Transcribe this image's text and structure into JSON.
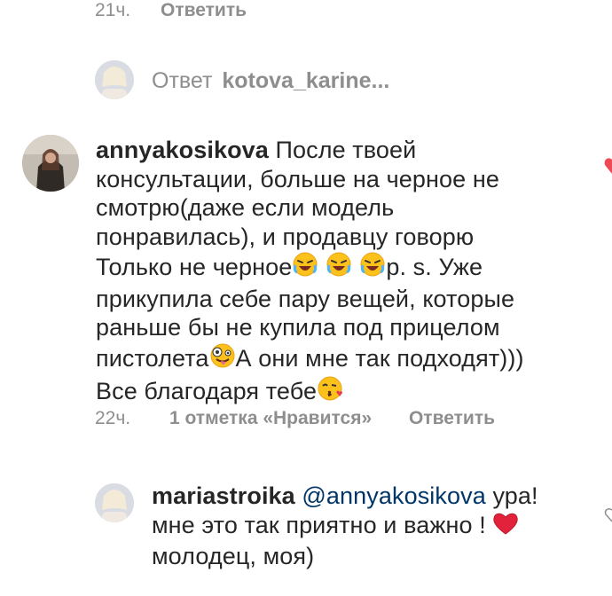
{
  "top_comment_meta": {
    "time": "21ч.",
    "reply": "Ответить"
  },
  "view_replies": {
    "prefix": "Ответ",
    "user": "kotova_karine..."
  },
  "comment1": {
    "username": "annyakosikova",
    "lines": [
      "После твоей",
      "консультации, больше на черное не",
      "смотрю(даже если модель",
      "понравилась), и продавцу говорю"
    ],
    "line5_text": "Только не черное",
    "line5_after": "p. s. Уже",
    "line6": "прикупила себе пару вещей, которые",
    "line7": "раньше бы не купила под прицелом",
    "line8_before": "пистолета",
    "line8_after": "А они мне так подходят)))",
    "line9": "Все благодаря тебе",
    "meta": {
      "time": "22ч.",
      "likes": "1 отметка «Нравится»",
      "reply": "Ответить"
    },
    "emojis": [
      "rofl-face",
      "rofl-face",
      "rofl-face",
      "zany-face",
      "kissing-face"
    ]
  },
  "comment2": {
    "username": "mariastroika",
    "mention": "@annyakosikova",
    "line1_after": "ура!",
    "line2": "мне это так приятно и важно !",
    "line3": "молодец, моя)",
    "emoji": "red-heart"
  },
  "colors": {
    "text": "#262626",
    "meta": "#8e8e8e",
    "mention": "#003569",
    "like": "#ed4956"
  }
}
